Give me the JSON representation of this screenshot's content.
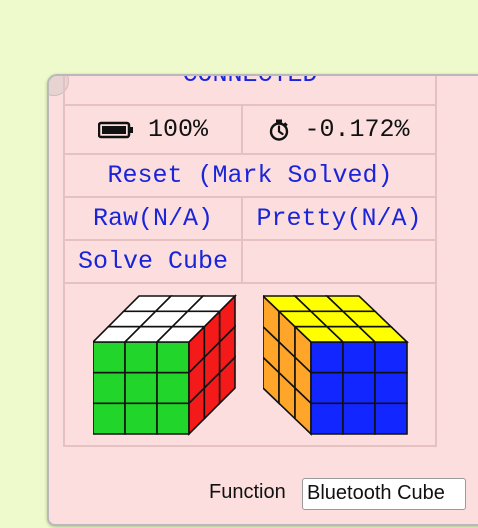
{
  "panel": {
    "connection_label": "CONNECTED",
    "battery": {
      "icon": "battery-icon",
      "value": "100%",
      "level": 1.0
    },
    "stopwatch": {
      "icon": "stopwatch-icon",
      "value": "-0.172%"
    },
    "reset_label": "Reset (Mark Solved)",
    "raw_label": "Raw(N/A)",
    "pretty_label": "Pretty(N/A)",
    "solve_label": "Solve Cube",
    "cube_views": [
      {
        "name": "front-view",
        "top": "white",
        "left": "green",
        "right": "red"
      },
      {
        "name": "back-view",
        "top": "yellow",
        "left": "orange",
        "right": "blue"
      }
    ],
    "function_label": "Function",
    "function_value": "Bluetooth Cube"
  },
  "colors": {
    "background": "#eefacb",
    "panel": "#fcdede",
    "link_text": "#1a25d9",
    "white": "#ffffff",
    "green": "#22d52b",
    "red": "#f41a1a",
    "yellow": "#ffff00",
    "orange": "#ffa52a",
    "blue": "#1226ff"
  }
}
